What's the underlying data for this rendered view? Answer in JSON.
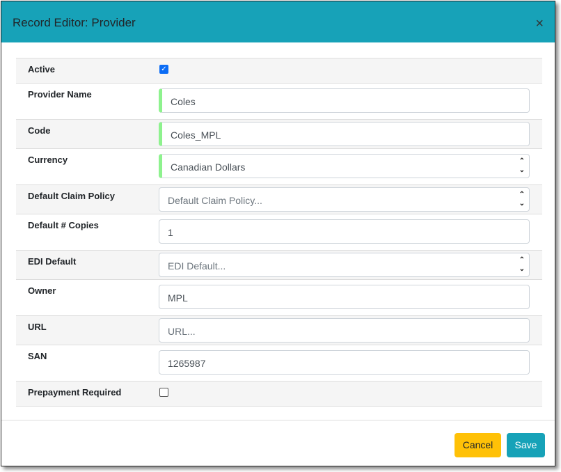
{
  "dialog": {
    "title": "Record Editor: Provider",
    "close_label": "×"
  },
  "fields": {
    "active": {
      "label": "Active",
      "checked": true
    },
    "provider_name": {
      "label": "Provider Name",
      "value": "Coles"
    },
    "code": {
      "label": "Code",
      "value": "Coles_MPL"
    },
    "currency": {
      "label": "Currency",
      "value": "Canadian Dollars"
    },
    "claim_policy": {
      "label": "Default Claim Policy",
      "placeholder": "Default Claim Policy..."
    },
    "copies": {
      "label": "Default # Copies",
      "value": "1"
    },
    "edi": {
      "label": "EDI Default",
      "placeholder": "EDI Default..."
    },
    "owner": {
      "label": "Owner",
      "value": "MPL"
    },
    "url": {
      "label": "URL",
      "placeholder": "URL..."
    },
    "san": {
      "label": "SAN",
      "value": "1265987"
    },
    "prepayment": {
      "label": "Prepayment Required",
      "checked": false
    }
  },
  "footer": {
    "cancel_label": "Cancel",
    "save_label": "Save"
  },
  "colors": {
    "header": "#17a2b8",
    "cancel": "#ffc107",
    "save": "#17a2b8",
    "required_marker": "#8ef28e"
  }
}
